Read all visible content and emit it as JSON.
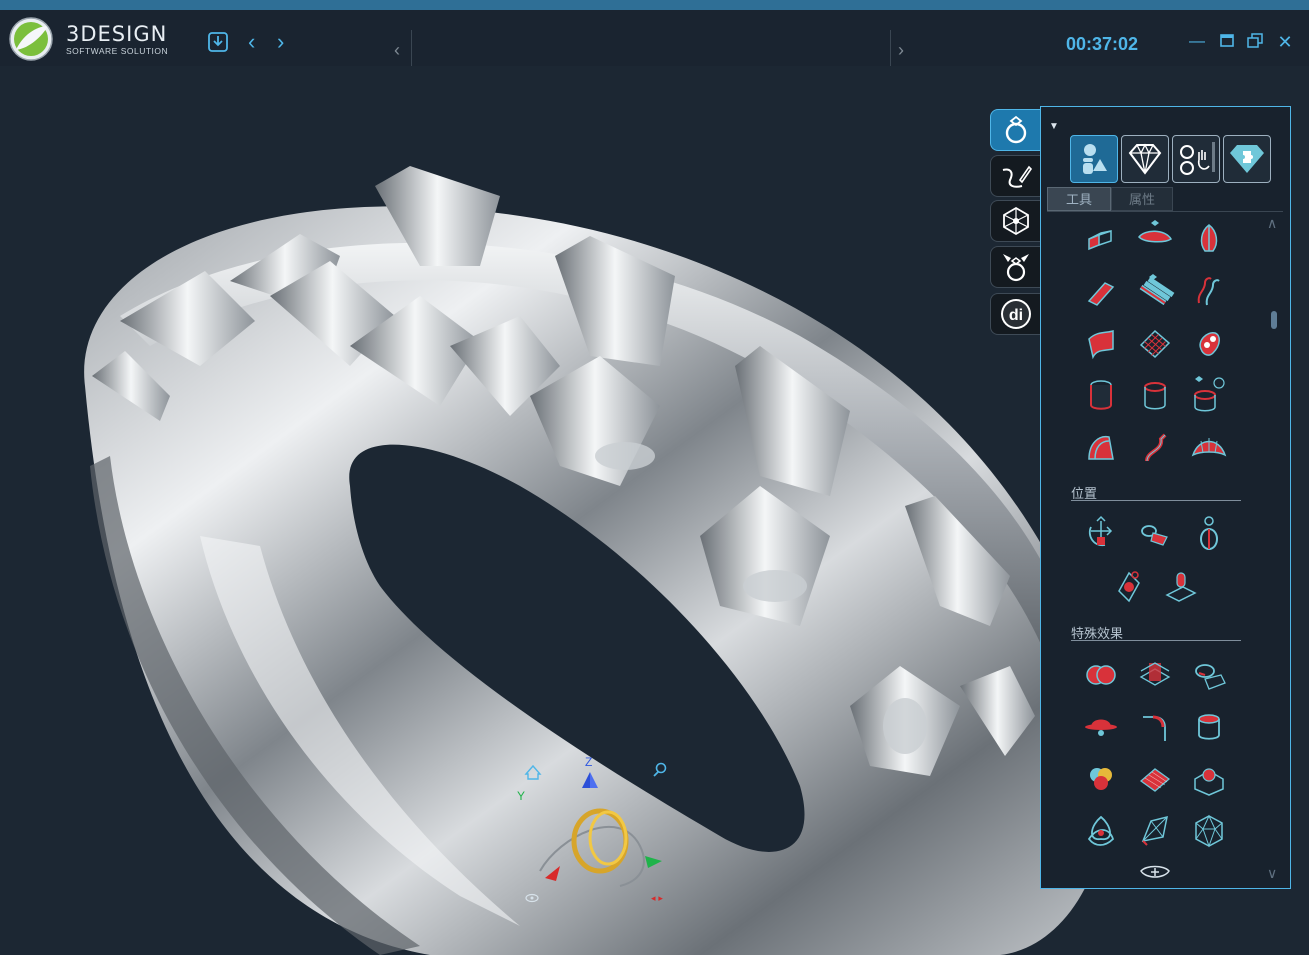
{
  "app": {
    "brand": "3DESIGN",
    "brand_sub": "SOFTWARE SOLUTION",
    "timer": "00:37:02"
  },
  "titlebar": {
    "save_icon": "save-icon",
    "prev_icon": "chevron-left-icon",
    "next_icon": "chevron-right-icon",
    "left_scroll_icon": "chevron-left-icon",
    "right_scroll_icon": "chevron-right-icon",
    "window_buttons": [
      "minimize-icon",
      "maximize-icon",
      "restore-icon",
      "close-icon"
    ]
  },
  "viewport": {
    "gizmo": {
      "z_label": "Z",
      "y_label": "Y"
    }
  },
  "side_tools": [
    {
      "name": "ring-icon",
      "active": true
    },
    {
      "name": "pen-curve-icon",
      "active": false
    },
    {
      "name": "mesh-network-icon",
      "active": false
    },
    {
      "name": "ring-gems-icon",
      "active": false
    },
    {
      "name": "di-icon",
      "label": "di",
      "active": false
    }
  ],
  "panel": {
    "categories": [
      {
        "name": "shapes-icon",
        "active": true
      },
      {
        "name": "diamond-icon",
        "active": false
      },
      {
        "name": "rings-hand-icon",
        "active": false
      },
      {
        "name": "puzzle-diamond-icon",
        "active": false
      }
    ],
    "tabs": {
      "tools": "工具",
      "properties": "属性"
    },
    "sections": {
      "position": "位置",
      "effects": "特殊效果"
    },
    "bottom_icon": "add-profile-icon"
  },
  "colors": {
    "accent": "#4fb6e8",
    "tool_red": "#d8323a",
    "tool_cyan": "#6fc7d9",
    "panel_bg": "#18222d"
  }
}
